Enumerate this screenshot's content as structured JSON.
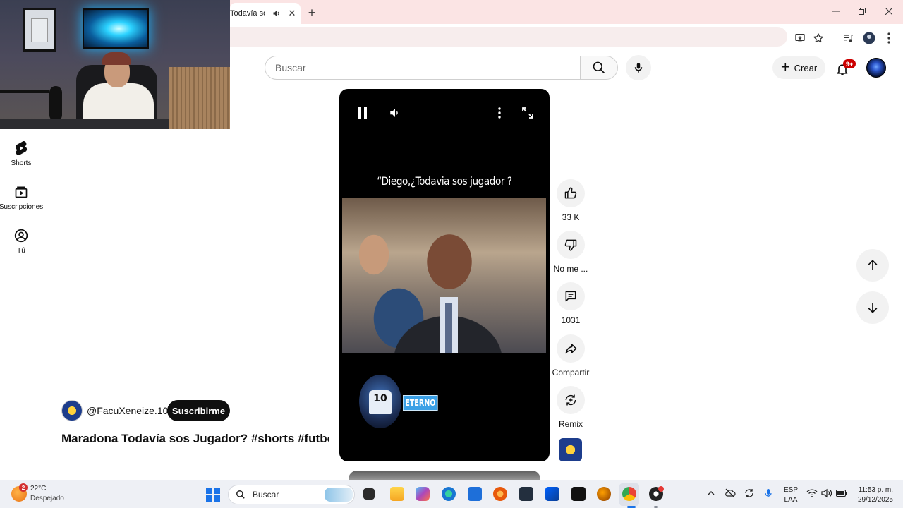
{
  "browser": {
    "tab_title": "Todavía sos",
    "tab_close": "✕",
    "new_tab": "+",
    "window_controls": [
      "minimize",
      "maximize",
      "close"
    ]
  },
  "header": {
    "search_placeholder": "Buscar",
    "create_label": "Crear",
    "notification_count": "9+"
  },
  "sidebar": {
    "items": [
      {
        "label": "Shorts",
        "icon": "shorts-icon"
      },
      {
        "label": "Suscripciones",
        "icon": "subscriptions-icon"
      },
      {
        "label": "Tú",
        "icon": "you-icon"
      }
    ]
  },
  "player": {
    "caption": "“Diego,¿Todavia sos jugador ?",
    "logo_number": "10",
    "logo_tag": "ETERNO"
  },
  "channel": {
    "name": "@FacuXeneize.10",
    "subscribe_label": "Suscribirme"
  },
  "video": {
    "title": "Maradona Todavía sos Jugador? #shorts #futbo..."
  },
  "actions": {
    "likes": "33 K",
    "dislike_label": "No me ...",
    "comments": "1031",
    "share_label": "Compartir",
    "remix_label": "Remix"
  },
  "taskbar": {
    "weather_badge": "2",
    "temperature": "22°C",
    "weather": "Despejado",
    "search_label": "Buscar",
    "language_line1": "ESP",
    "language_line2": "LAA",
    "time": "11:53 p. m.",
    "date": "29/12/2025"
  },
  "colors": {
    "tab_strip": "#fbe4e4",
    "subscribe_bg": "#0f0f0f",
    "notification_badge": "#cc0000",
    "windows_accent": "#1a73e8"
  }
}
